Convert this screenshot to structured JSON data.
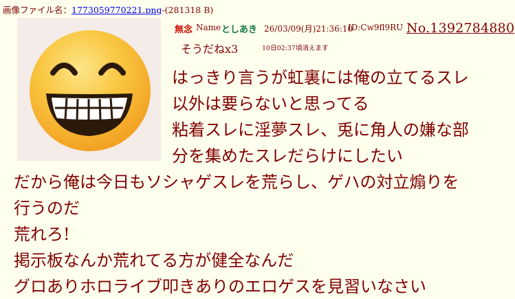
{
  "file_info": {
    "prefix": "画像ファイル名：",
    "filename": "1773059770221.png",
    "size": "-(281318 B)"
  },
  "post": {
    "subject": "無念",
    "name_label": "Name",
    "name": "としあき",
    "datetime": "26/03/09(月)21:36:10",
    "id": "ID:Cw9fl9RU",
    "number": "No.1392784880",
    "reaction": "そうだねx3",
    "expire": "10日02:37頃消えます",
    "body_upper": [
      "はっきり言うが虹裏には俺の立てるスレ",
      "以外は要らないと思ってる",
      "粘着スレに淫夢スレ、兎に角人の嫌な部",
      "分を集めたスレだらけにしたい"
    ],
    "body_lower": [
      "だから俺は今日もソシャゲスレを荒らし、ゲハの対立煽りを",
      "行うのだ",
      "荒れろ!",
      "掲示板なんか荒れてる方が健全なんだ",
      "グロありホロライブ叩きありのエロゲスを見習いなさい"
    ]
  },
  "thumbnail": {
    "icon": "grinning-face-emoji",
    "face_color": "#f7b52a",
    "face_highlight": "#fde58a",
    "background": "#f4ece8"
  }
}
